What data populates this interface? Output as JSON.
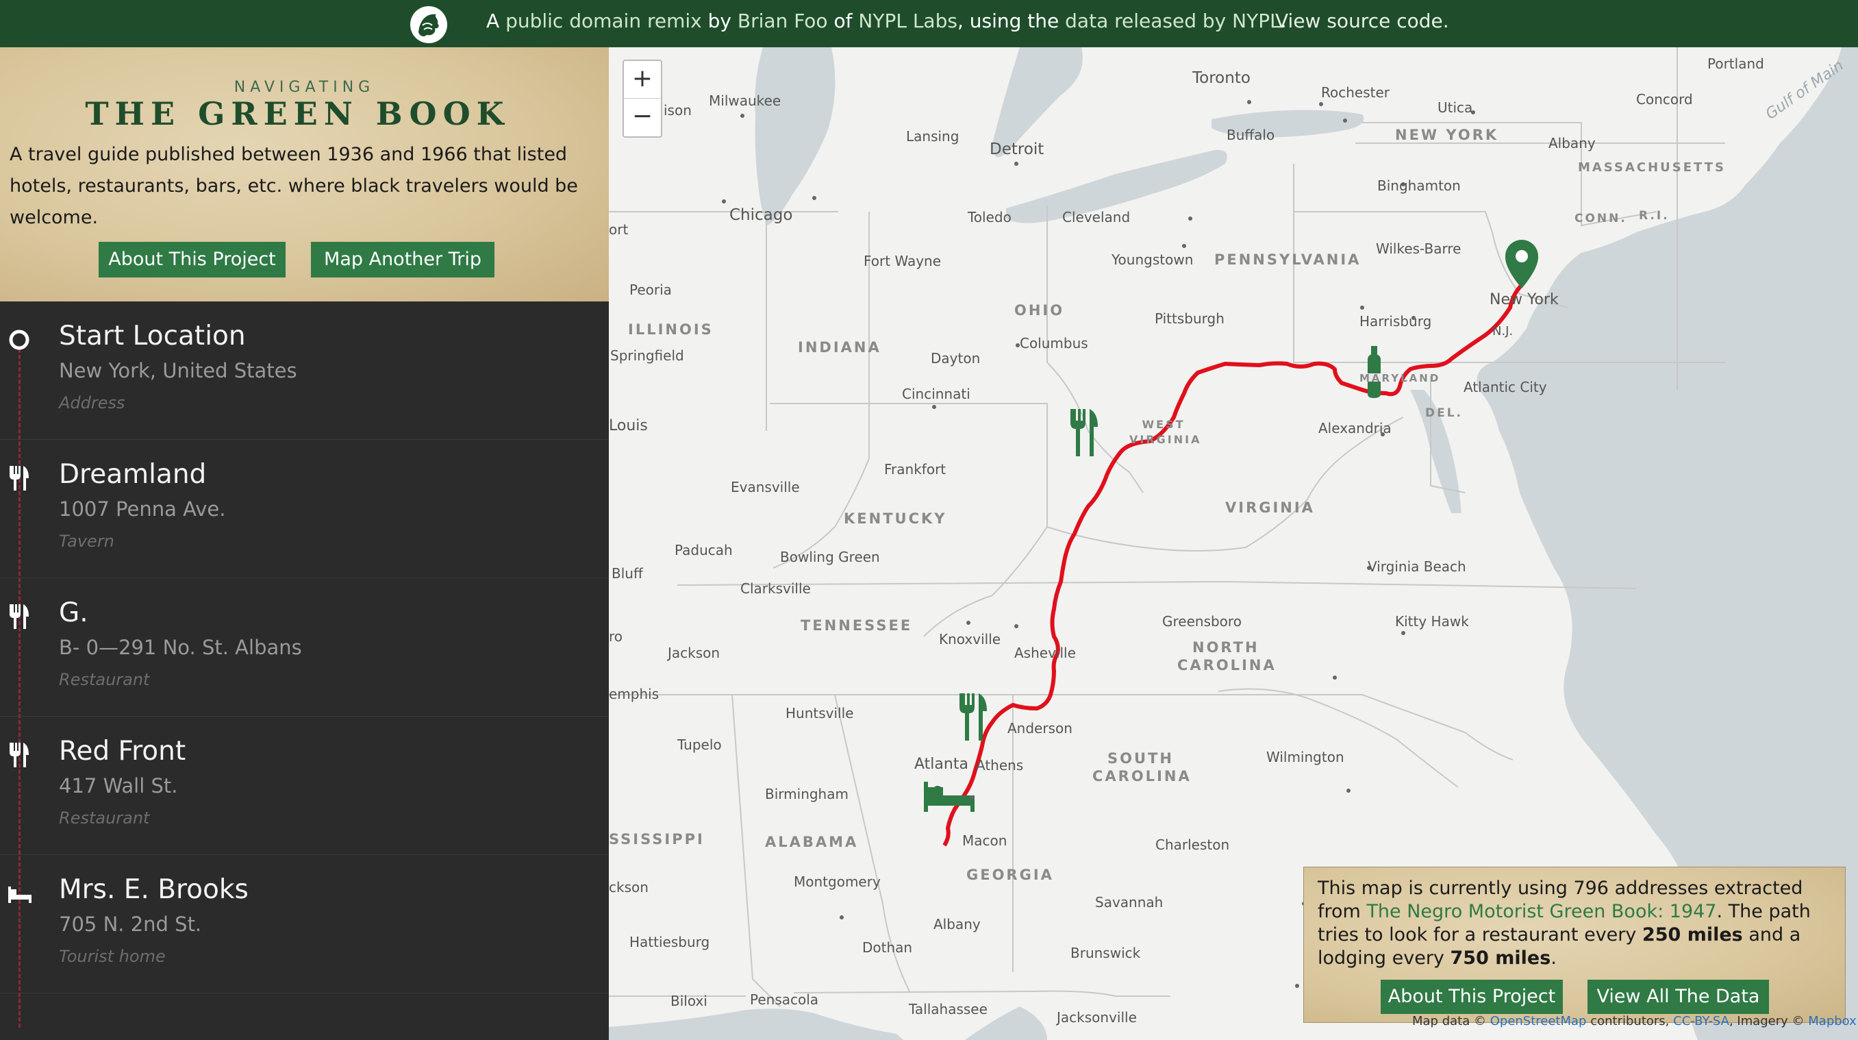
{
  "topbar": {
    "credit_a": "A",
    "credit_b": "public domain remix",
    "credit_c": "by",
    "credit_d": "Brian Foo",
    "credit_e": "of",
    "credit_f": "NYPL Labs",
    "credit_g": ", using the",
    "credit_h": "data released by NYPL",
    "credit_i": ".",
    "source_link": "View source code."
  },
  "header": {
    "kicker": "NAVIGATING",
    "title": "THE GREEN BOOK",
    "description": "A travel guide published between 1936 and 1966 that listed hotels, restaurants, bars, etc. where black travelers would be welcome.",
    "about_button": "About This Project",
    "another_trip_button": "Map Another Trip"
  },
  "itinerary": [
    {
      "icon": "circle-icon",
      "name": "Start Location",
      "address": "New York, United States",
      "type": "Address"
    },
    {
      "icon": "fork-knife-icon",
      "name": "Dreamland",
      "address": "1007 Penna Ave.",
      "type": "Tavern"
    },
    {
      "icon": "fork-knife-icon",
      "name": "G.",
      "address": "B- 0—291 No. St. Albans",
      "type": "Restaurant"
    },
    {
      "icon": "fork-knife-icon",
      "name": "Red Front",
      "address": "417 Wall St.",
      "type": "Restaurant"
    },
    {
      "icon": "bed-icon",
      "name": "Mrs. E. Brooks",
      "address": "705 N. 2nd St.",
      "type": "Tourist home"
    }
  ],
  "map": {
    "zoom_in": "+",
    "zoom_out": "−",
    "route_color": "#e0101c",
    "accent_color": "#2f7a45",
    "places": [
      "Milwaukee",
      "ison",
      "Lansing",
      "Detroit",
      "Toronto",
      "Rochester",
      "Utica",
      "Portland",
      "Concord",
      "Buffalo",
      "NEW YORK",
      "Albany",
      "MASSACHUSETTS",
      "Binghamton",
      "Chicago",
      "Toledo",
      "Cleveland",
      "CONN.",
      "R.I.",
      "ort",
      "Fort Wayne",
      "Youngstown",
      "PENNSYLVANIA",
      "Wilkes-Barre",
      "New York",
      "Peoria",
      "OHIO",
      "Pittsburgh",
      "Harrisburg",
      "ILLINOIS",
      "INDIANA",
      "Columbus",
      "N.J.",
      "Springfield",
      "Dayton",
      "MARYLAND",
      "Atlantic City",
      "Cincinnati",
      "DEL.",
      "Louis",
      "WEST VIRGINIA",
      "Alexandria",
      "Frankfort",
      "Evansville",
      "KENTUCKY",
      "VIRGINIA",
      "Paducah",
      "Bowling Green",
      "Virginia Beach",
      "Bluff",
      "Clarksville",
      "TENNESSEE",
      "Greensboro",
      "Kitty Hawk",
      "ro",
      "Knoxville",
      "Asheville",
      "NORTH",
      "CAROLINA",
      "Jackson",
      "emphis",
      "Huntsville",
      "Anderson",
      "Tupelo",
      "SOUTH",
      "CAROLINA",
      "Wilmington",
      "Atlanta",
      "Athens",
      "Birmingham",
      "SSISSIPPI",
      "ALABAMA",
      "Macon",
      "Charleston",
      "GEORGIA",
      "ckson",
      "Montgomery",
      "Savannah",
      "Albany",
      "Hattiesburg",
      "Dothan",
      "Brunswick",
      "Biloxi",
      "Pensacola",
      "Tallahassee",
      "Jacksonville",
      "Gulf of Main"
    ]
  },
  "info": {
    "t1": "This map is currently using 796 addresses extracted from",
    "t2": "The Negro Motorist Green Book: 1947",
    "t3": ". The path tries to look for a restaurant every",
    "t4": "250 miles",
    "t5": "and a lodging every",
    "t6": "750 miles",
    "t7": ".",
    "about_button": "About This Project",
    "data_button": "View All The Data"
  },
  "attribution": {
    "a": "Map data ©",
    "b": "OpenStreetMap",
    "c": "contributors,",
    "d": "CC-BY-SA",
    "e": ", Imagery ©",
    "f": "Mapbox"
  }
}
